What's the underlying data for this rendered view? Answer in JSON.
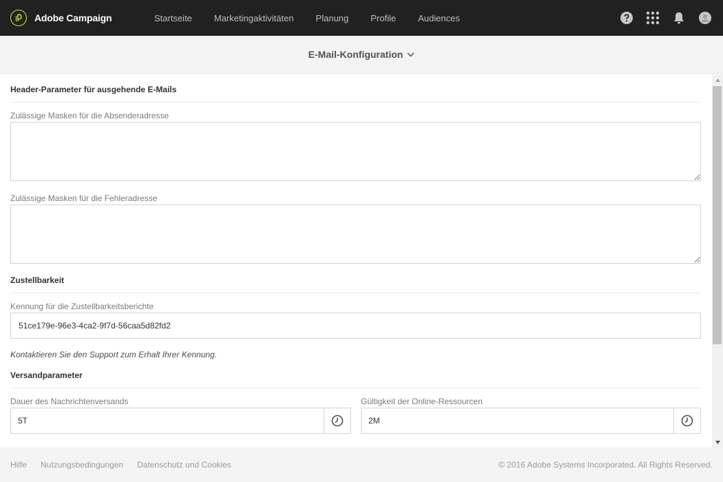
{
  "topbar": {
    "brand_name": "Adobe Campaign",
    "nav": [
      {
        "label": "Startseite"
      },
      {
        "label": "Marketingaktivitäten"
      },
      {
        "label": "Planung"
      },
      {
        "label": "Profile"
      },
      {
        "label": "Audiences"
      }
    ],
    "icons": [
      "help-icon",
      "apps-grid-icon",
      "notification-bell-icon",
      "user-avatar-icon"
    ]
  },
  "subheader": {
    "title": "E-Mail-Konfiguration"
  },
  "sections": {
    "header_params": {
      "title": "Header-Parameter für ausgehende E-Mails",
      "sender_mask_label": "Zulässige Masken für die Absenderadresse",
      "sender_mask_value": "",
      "error_mask_label": "Zulässige Masken für die Fehleradresse",
      "error_mask_value": ""
    },
    "deliverability": {
      "title": "Zustellbarkeit",
      "id_label": "Kennung für die Zustellbarkeitsberichte",
      "id_value": "51ce179e-96e3-4ca2-9f7d-56caa5d82fd2",
      "hint": "Kontaktieren Sie den Support zum Erhalt Ihrer Kennung."
    },
    "delivery_params": {
      "title": "Versandparameter",
      "duration_label": "Dauer des Nachrichtenversands",
      "duration_value": "5T",
      "validity_label": "Gültigkeit der Online-Ressourcen",
      "validity_value": "2M"
    }
  },
  "footer": {
    "links": [
      {
        "label": "Hilfe"
      },
      {
        "label": "Nutzungsbedingungen"
      },
      {
        "label": "Datenschutz und Cookies"
      }
    ],
    "copyright": "© 2016 Adobe Systems Incorporated. All Rights Reserved."
  },
  "colors": {
    "topbar_bg": "#212121",
    "brand_accent": "#d8e43a",
    "nav_text": "#bdbdbd",
    "content_bg": "#ffffff",
    "footer_bg": "#f4f4f4"
  }
}
